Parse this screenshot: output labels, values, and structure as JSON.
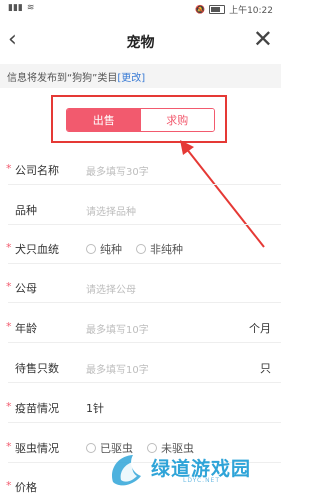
{
  "statusbar": {
    "signal": "▮▮▮",
    "wifi": "≋",
    "mute": "🔕",
    "time": "上午10:22"
  },
  "navbar": {
    "back": "‹",
    "title": "宠物",
    "close": "✕"
  },
  "notice": {
    "prefix": "信息将发布到“狗狗”类目",
    "link": "[更改]"
  },
  "segment": {
    "sell": "出售",
    "buy": "求购"
  },
  "form": {
    "company": {
      "label": "公司名称",
      "placeholder": "最多填写30字"
    },
    "breed": {
      "label": "品种",
      "placeholder": "请选择品种"
    },
    "bloodline": {
      "label": "犬只血统",
      "opt1": "纯种",
      "opt2": "非纯种"
    },
    "sex": {
      "label": "公母",
      "placeholder": "请选择公母"
    },
    "age": {
      "label": "年龄",
      "placeholder": "最多填写10字",
      "unit": "个月"
    },
    "count": {
      "label": "待售只数",
      "placeholder": "最多填写10字",
      "unit": "只"
    },
    "vaccine": {
      "label": "疫苗情况",
      "value": "1针"
    },
    "deworm": {
      "label": "驱虫情况",
      "opt1": "已驱虫",
      "opt2": "未驱虫"
    },
    "price": {
      "label": "价格"
    }
  },
  "watermark": {
    "text": "绿道游戏园",
    "sub": "LDYC.NET"
  },
  "colors": {
    "accent": "#f25a6e",
    "highlight": "#e53935",
    "link": "#3a7bd5"
  }
}
